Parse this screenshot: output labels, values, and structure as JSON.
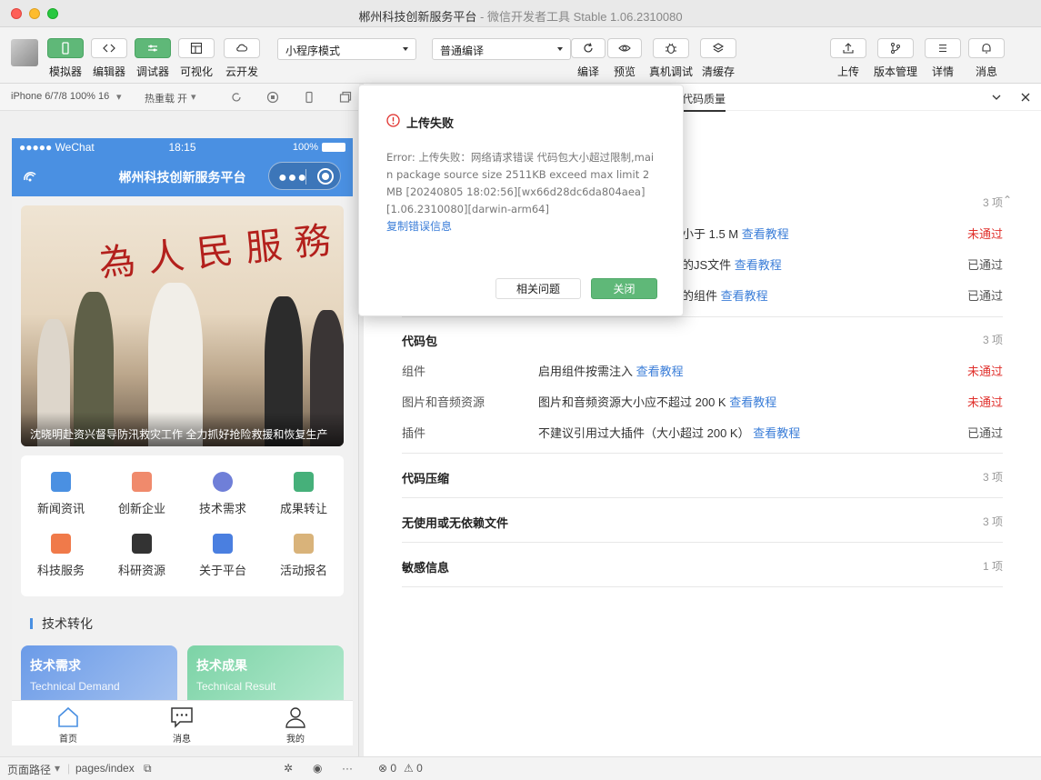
{
  "window": {
    "title": "郴州科技创新服务平台",
    "subtitle": "- 微信开发者工具 Stable 1.06.2310080"
  },
  "toolbar": {
    "left": [
      {
        "label": "模拟器",
        "icon": "phone-icon",
        "active": true
      },
      {
        "label": "编辑器",
        "icon": "code-icon",
        "active": false
      },
      {
        "label": "调试器",
        "icon": "sliders-icon",
        "active": true
      },
      {
        "label": "可视化",
        "icon": "layout-icon",
        "active": false
      },
      {
        "label": "云开发",
        "icon": "cloud-icon",
        "active": false
      }
    ],
    "mode_select": "小程序模式",
    "compile_select": "普通编译",
    "center": [
      {
        "label": "编译",
        "icon": "refresh-icon"
      },
      {
        "label": "预览",
        "icon": "eye-icon"
      },
      {
        "label": "真机调试",
        "icon": "bug-icon"
      },
      {
        "label": "清缓存",
        "icon": "layers-icon"
      }
    ],
    "right": [
      {
        "label": "上传",
        "icon": "upload-icon"
      },
      {
        "label": "版本管理",
        "icon": "branch-icon"
      },
      {
        "label": "详情",
        "icon": "menu-icon"
      },
      {
        "label": "消息",
        "icon": "bell-icon"
      }
    ]
  },
  "simbar": {
    "device": "iPhone 6/7/8 100% 16",
    "hotreload": "热重载 开"
  },
  "phone": {
    "status": {
      "carrier": "●●●●● WeChat",
      "time": "18:15",
      "battery": "100%"
    },
    "nav_title": "郴州科技创新服务平台",
    "banner": {
      "calligraphy": "為人民服務",
      "caption": "沈晓明赴资兴督导防汛救灾工作 全力抓好抢险救援和恢复生产"
    },
    "grid": [
      {
        "label": "新闻资讯",
        "color": "#4a90e2"
      },
      {
        "label": "创新企业",
        "color": "#f08a6c"
      },
      {
        "label": "技术需求",
        "color": "#6f7fd8"
      },
      {
        "label": "成果转让",
        "color": "#46b07a"
      },
      {
        "label": "科技服务",
        "color": "#f07a4a"
      },
      {
        "label": "科研资源",
        "color": "#333333"
      },
      {
        "label": "关于平台",
        "color": "#4a7fe0"
      },
      {
        "label": "活动报名",
        "color": "#d9b37a"
      }
    ],
    "section_title": "技术转化",
    "features": [
      {
        "title": "技术需求",
        "subtitle": "Technical Demand"
      },
      {
        "title": "技术成果",
        "subtitle": "Technical Result"
      }
    ],
    "tabs": [
      {
        "label": "首页"
      },
      {
        "label": "消息"
      },
      {
        "label": "我的"
      }
    ]
  },
  "simfoot": {
    "path_label": "页面路径",
    "path": "pages/index"
  },
  "right_panel": {
    "tab": "代码质量",
    "groups": [
      {
        "title": "",
        "count": "3 项",
        "rows": [
          {
            "name": "",
            "desc": "小于 1.5 M",
            "link": "查看教程",
            "status": "未通过"
          },
          {
            "name": "",
            "desc": "的JS文件",
            "link": "查看教程",
            "status": "已通过"
          },
          {
            "name": "",
            "desc": "的组件",
            "link": "查看教程",
            "status": "已通过"
          }
        ]
      },
      {
        "title": "代码包",
        "count": "3 项",
        "rows": [
          {
            "name": "组件",
            "desc": "启用组件按需注入",
            "link": "查看教程",
            "status": "未通过"
          },
          {
            "name": "图片和音频资源",
            "desc": "图片和音频资源大小应不超过 200 K",
            "link": "查看教程",
            "status": "未通过"
          },
          {
            "name": "插件",
            "desc": "不建议引用过大插件（大小超过 200 K）",
            "link": "查看教程",
            "status": "已通过"
          }
        ]
      },
      {
        "title": "代码压缩",
        "count": "3 项"
      },
      {
        "title": "无使用或无依赖文件",
        "count": "3 项"
      },
      {
        "title": "敏感信息",
        "count": "1 项"
      }
    ],
    "footer": {
      "errors": "0",
      "warnings": "0"
    }
  },
  "dialog": {
    "title": "上传失败",
    "body": "Error: 上传失败：网络请求错误 代码包大小超过限制,main package source size 2511KB exceed max limit 2MB [20240805 18:02:56][wx66d28dc6da804aea][1.06.2310080][darwin-arm64]",
    "copy_link": "复制错误信息",
    "btn_related": "相关问题",
    "btn_close": "关闭"
  }
}
